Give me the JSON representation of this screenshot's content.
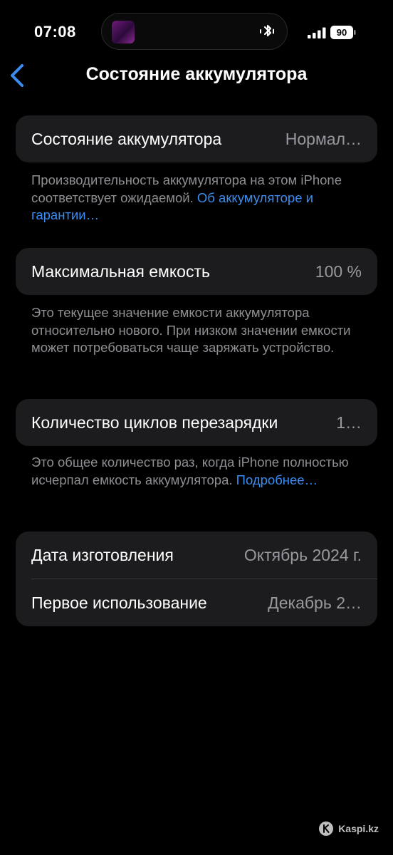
{
  "status_bar": {
    "time": "07:08",
    "battery_level": "90",
    "icons": [
      "bluetooth-icon",
      "signal-icon",
      "battery-icon"
    ]
  },
  "nav": {
    "title": "Состояние аккумулятора"
  },
  "battery_health": {
    "label": "Состояние аккумулятора",
    "value": "Нормал…",
    "note_text": "Производительность аккумулятора на этом iPhone соответствует ожидаемой. ",
    "note_link": "Об аккумуляторе и гарантии…"
  },
  "max_capacity": {
    "label": "Максимальная емкость",
    "value": "100 %",
    "note_text": "Это текущее значение емкости аккумулятора относительно нового. При низком значении емкости может потребоваться чаще заряжать устройство."
  },
  "cycle_count": {
    "label": "Количество циклов перезарядки",
    "value": "1…",
    "note_text": "Это общее количество раз, когда iPhone полностью исчерпал емкость аккумулятора. ",
    "note_link": "Подробнее…"
  },
  "dates": {
    "manufacture_label": "Дата изготовления",
    "manufacture_value": "Октябрь 2024 г.",
    "first_use_label": "Первое использование",
    "first_use_value": "Декабрь 2…"
  },
  "watermark": {
    "text": "Kaspi.kz"
  },
  "colors": {
    "background": "#000000",
    "card": "#1c1c1e",
    "link": "#3a8cf0",
    "secondary_text": "#98989f"
  }
}
